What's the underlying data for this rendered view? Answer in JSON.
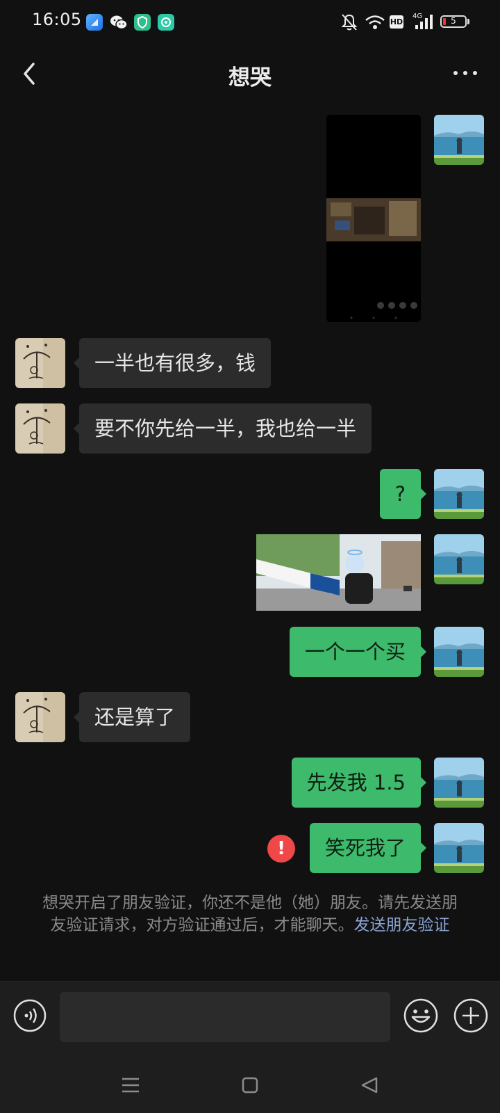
{
  "status_bar": {
    "time": "16:05",
    "app_icons": [
      "blue-app-icon",
      "wechat-icon",
      "green-shield-app-icon",
      "teal-chat-app-icon"
    ],
    "icons": [
      "mute-bell-icon",
      "wifi-icon",
      "hd-icon",
      "cellular-4g-icon",
      "battery-icon"
    ],
    "hd_label": "HD",
    "network_label": "4G",
    "battery_level": "5",
    "battery_color": "#e53935"
  },
  "header": {
    "title": "想哭",
    "back_icon": "chevron-left-icon",
    "more_icon": "more-dots-icon"
  },
  "colors": {
    "background": "#111111",
    "incoming_bubble": "#2c2c2c",
    "outgoing_bubble": "#3dba6b",
    "error": "#f04848",
    "link": "#8aa4d4"
  },
  "messages": [
    {
      "side": "out",
      "type": "video"
    },
    {
      "side": "in",
      "type": "text",
      "text": "一半也有很多，钱"
    },
    {
      "side": "in",
      "type": "text",
      "text": "要不你先给一半，我也给一半"
    },
    {
      "side": "out",
      "type": "text",
      "text": "?"
    },
    {
      "side": "out",
      "type": "image"
    },
    {
      "side": "out",
      "type": "text",
      "text": "一个一个买"
    },
    {
      "side": "in",
      "type": "text",
      "text": "还是算了"
    },
    {
      "side": "out",
      "type": "text",
      "text": "先发我 1.5"
    },
    {
      "side": "out",
      "type": "text",
      "text": "笑死我了",
      "failed": true,
      "error_mark": "!"
    }
  ],
  "system_notice": {
    "text": "想哭开启了朋友验证，你还不是他（她）朋友。请先发送朋友验证请求，对方验证通过后，才能聊天。",
    "link": "发送朋友验证"
  },
  "input_bar": {
    "value": "",
    "placeholder": "",
    "voice_icon": "voice-icon",
    "emoji_icon": "emoji-icon",
    "plus_icon": "plus-circle-icon"
  },
  "nav_bar": {
    "icons": [
      "menu-icon",
      "home-square-icon",
      "back-triangle-icon"
    ]
  }
}
